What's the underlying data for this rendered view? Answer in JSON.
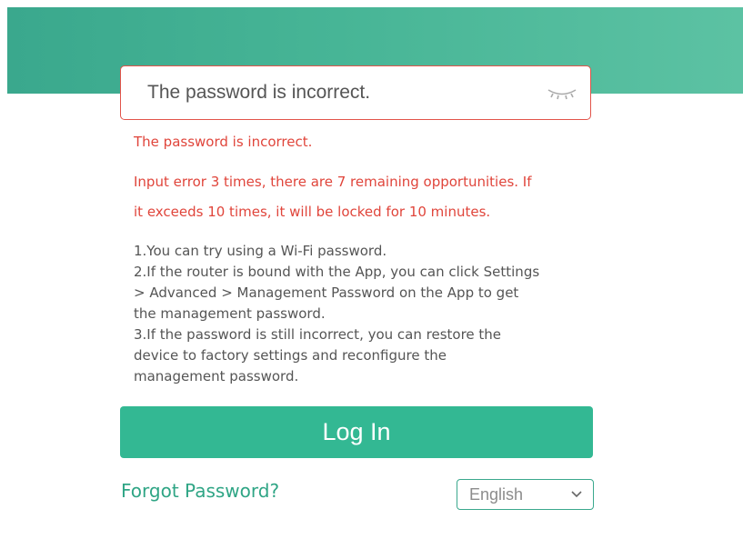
{
  "password_field": {
    "value": "The password is incorrect.",
    "visibility_icon": "eye-closed-icon"
  },
  "errors": {
    "main": "The password is incorrect.",
    "attempts_line1": "Input error 3 times, there are 7 remaining opportunities. If",
    "attempts_line2": "it exceeds 10 times, it will be locked for 10 minutes."
  },
  "help": {
    "lines": [
      "1.You can try using a Wi-Fi password.",
      "2.If the router is bound with the App, you can click Settings",
      "> Advanced > Management Password on the App to get",
      "the management password.",
      "3.If the password is still incorrect, you can restore the",
      "device to factory settings and reconfigure the",
      "management password."
    ]
  },
  "login_button": {
    "label": "Log In"
  },
  "forgot_link": {
    "label": "Forgot Password?"
  },
  "language": {
    "selected": "English",
    "icon": "chevron-down-icon"
  },
  "colors": {
    "header": "#47b596",
    "accent": "#33b893",
    "error": "#e0453b",
    "text": "#555555"
  }
}
